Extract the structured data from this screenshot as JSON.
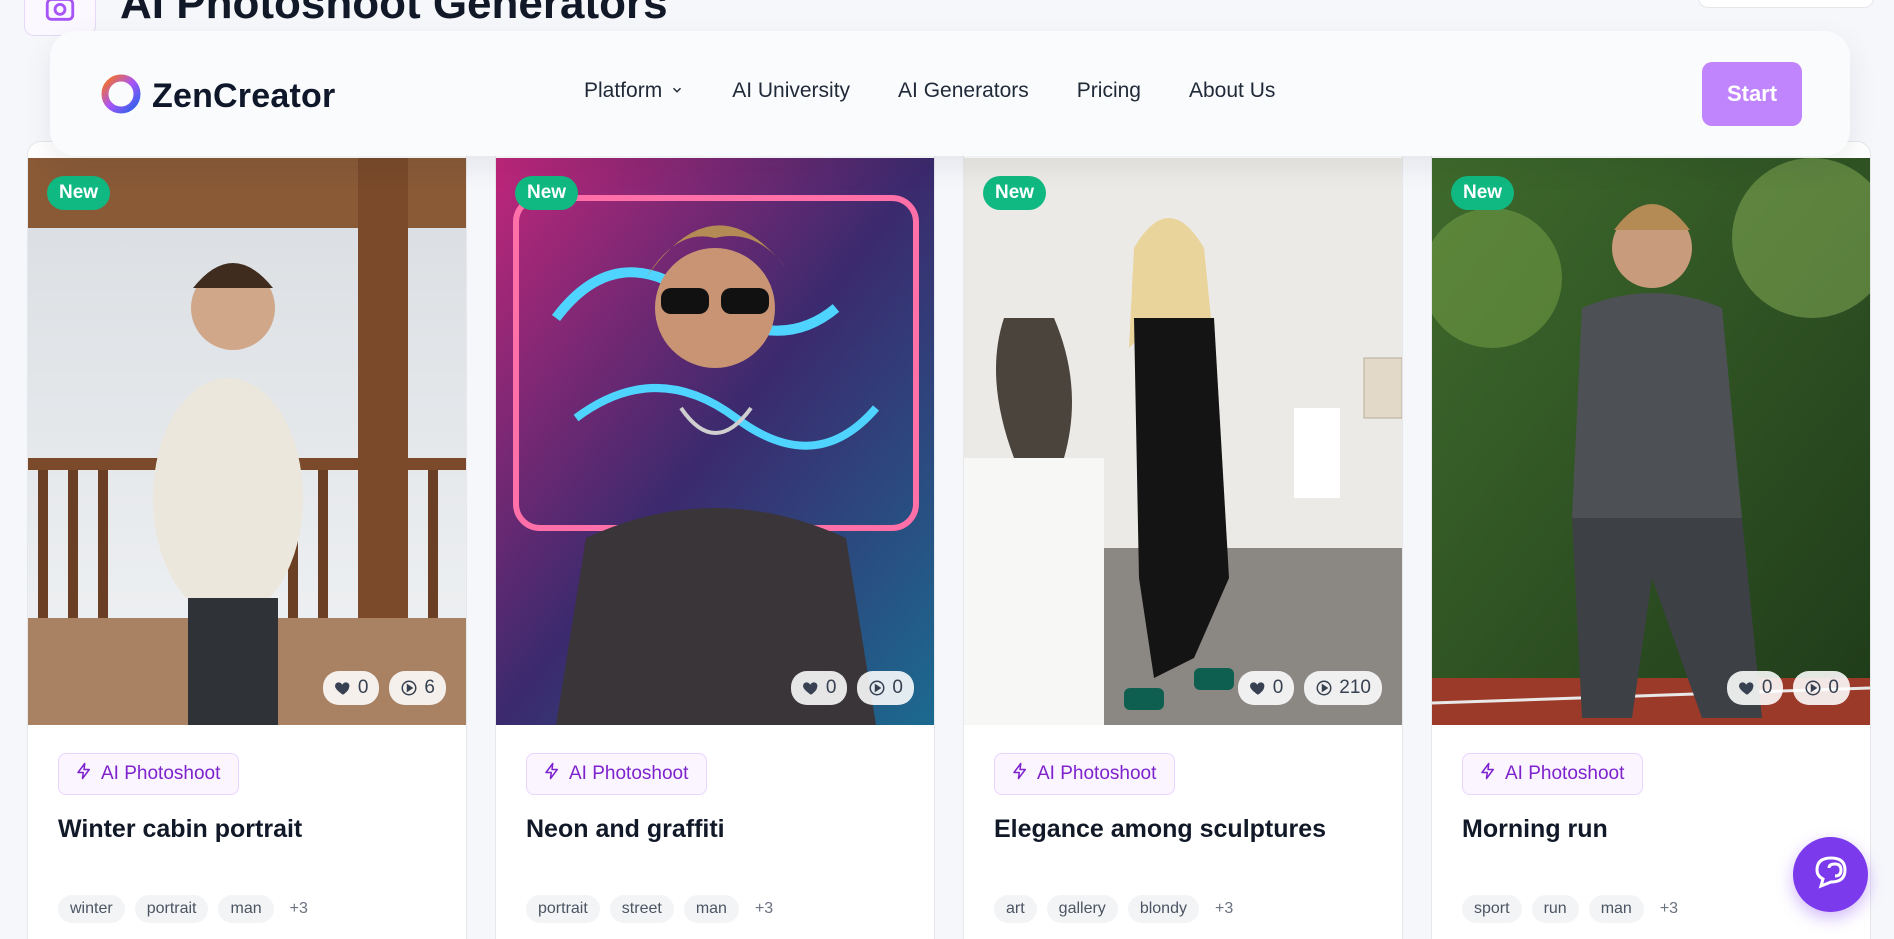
{
  "page": {
    "title": "AI Photoshoot Generators"
  },
  "nav": {
    "brand": "ZenCreator",
    "links": [
      "Platform",
      "AI University",
      "AI Generators",
      "Pricing",
      "About Us"
    ],
    "start_label": "Start"
  },
  "cards": [
    {
      "badge": "New",
      "likes": "0",
      "views": "6",
      "category": "AI Photoshoot",
      "title": "Winter cabin portrait",
      "tags": [
        "winter",
        "portrait",
        "man"
      ],
      "more": "+3"
    },
    {
      "badge": "New",
      "likes": "0",
      "views": "0",
      "category": "AI Photoshoot",
      "title": "Neon and graffiti",
      "tags": [
        "portrait",
        "street",
        "man"
      ],
      "more": "+3"
    },
    {
      "badge": "New",
      "likes": "0",
      "views": "210",
      "category": "AI Photoshoot",
      "title": "Elegance among sculptures",
      "tags": [
        "art",
        "gallery",
        "blondy"
      ],
      "more": "+3"
    },
    {
      "badge": "New",
      "likes": "0",
      "views": "0",
      "category": "AI Photoshoot",
      "title": "Morning run",
      "tags": [
        "sport",
        "run",
        "man"
      ],
      "more": "+3"
    }
  ],
  "icons": {
    "logo": "ring-logo-icon",
    "platform_chevron": "chevron-down-icon",
    "likes": "heart-icon",
    "views": "play-circle-icon",
    "category": "lightning-icon",
    "chat": "chat-bubble-icon"
  },
  "colors": {
    "accent": "#c084fc",
    "badge_new": "#10b981",
    "category_text": "#7e22ce",
    "chat": "#7c3aed"
  }
}
